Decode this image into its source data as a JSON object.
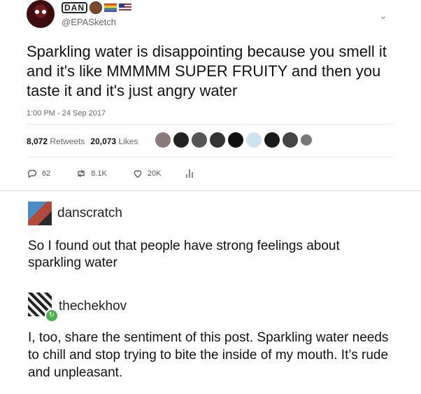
{
  "tweet": {
    "name_text": "DAN",
    "handle": "@EPASketch",
    "text": "Sparkling water is disappointing because you smell it and it's like MMMMM SUPER FRUITY and then you taste it and it's just angry water",
    "timestamp": "1:00 PM - 24 Sep 2017",
    "retweets_count": "8,072",
    "retweets_label": "Retweets",
    "likes_count": "20,073",
    "likes_label": "Likes",
    "actions": {
      "replies": "62",
      "retweets": "8.1K",
      "likes": "20K"
    }
  },
  "posts": [
    {
      "username": "danscratch",
      "text": "So I found out that people have strong feelings about sparkling water"
    },
    {
      "username": "thechekhov",
      "text": "I, too, share the sentiment of this post. Sparkling water needs to chill and stop trying to bite the inside of my mouth. It’s rude and unpleasant."
    }
  ],
  "icons": {
    "reply": "reply-icon",
    "retweet": "retweet-icon",
    "like": "heart-icon",
    "analytics": "analytics-icon",
    "more": "chevron-down-icon"
  }
}
